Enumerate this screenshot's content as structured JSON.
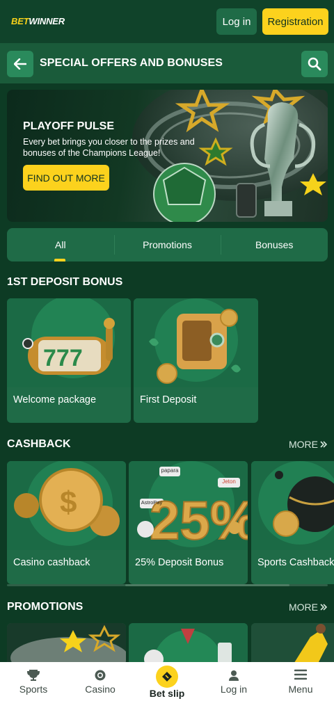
{
  "header": {
    "logo_left": "BET",
    "logo_right": "WINNER",
    "login_label": "Log in",
    "register_label": "Registration"
  },
  "subheader": {
    "title": "SPECIAL OFFERS AND BONUSES"
  },
  "banner": {
    "title": "PLAYOFF PULSE",
    "description": "Every bet brings you closer to the prizes and bonuses of the Champions League!",
    "cta_label": "FIND OUT MORE"
  },
  "tabs": [
    {
      "label": "All",
      "active": true
    },
    {
      "label": "Promotions",
      "active": false
    },
    {
      "label": "Bonuses",
      "active": false
    }
  ],
  "sections": {
    "first_deposit": {
      "title": "1ST DEPOSIT BONUS",
      "cards": [
        {
          "label": "Welcome package",
          "icon": "slot-machine-icon"
        },
        {
          "label": "First Deposit",
          "icon": "safe-icon"
        }
      ]
    },
    "cashback": {
      "title": "CASHBACK",
      "more_label": "MORE",
      "cards": [
        {
          "label": "Casino cashback",
          "icon": "coins-icon"
        },
        {
          "label": "25% Deposit Bonus",
          "icon": "percent-icon",
          "badges": [
            "papara",
            "Jeton",
            "AstroPay"
          ],
          "art_text": "25%"
        },
        {
          "label": "Sports Cashback",
          "icon": "sports-balls-icon"
        }
      ]
    },
    "promotions": {
      "title": "PROMOTIONS",
      "more_label": "MORE"
    }
  },
  "bottom_nav": [
    {
      "label": "Sports",
      "icon": "trophy-icon"
    },
    {
      "label": "Casino",
      "icon": "casino-chip-icon"
    },
    {
      "label": "Bet slip",
      "icon": "ticket-icon"
    },
    {
      "label": "Log in",
      "icon": "user-icon"
    },
    {
      "label": "Menu",
      "icon": "hamburger-icon"
    }
  ],
  "colors": {
    "background": "#0d3b24",
    "accent_yellow": "#fcd21d",
    "card": "#1f6b47",
    "button_green": "#2a8a5c"
  }
}
